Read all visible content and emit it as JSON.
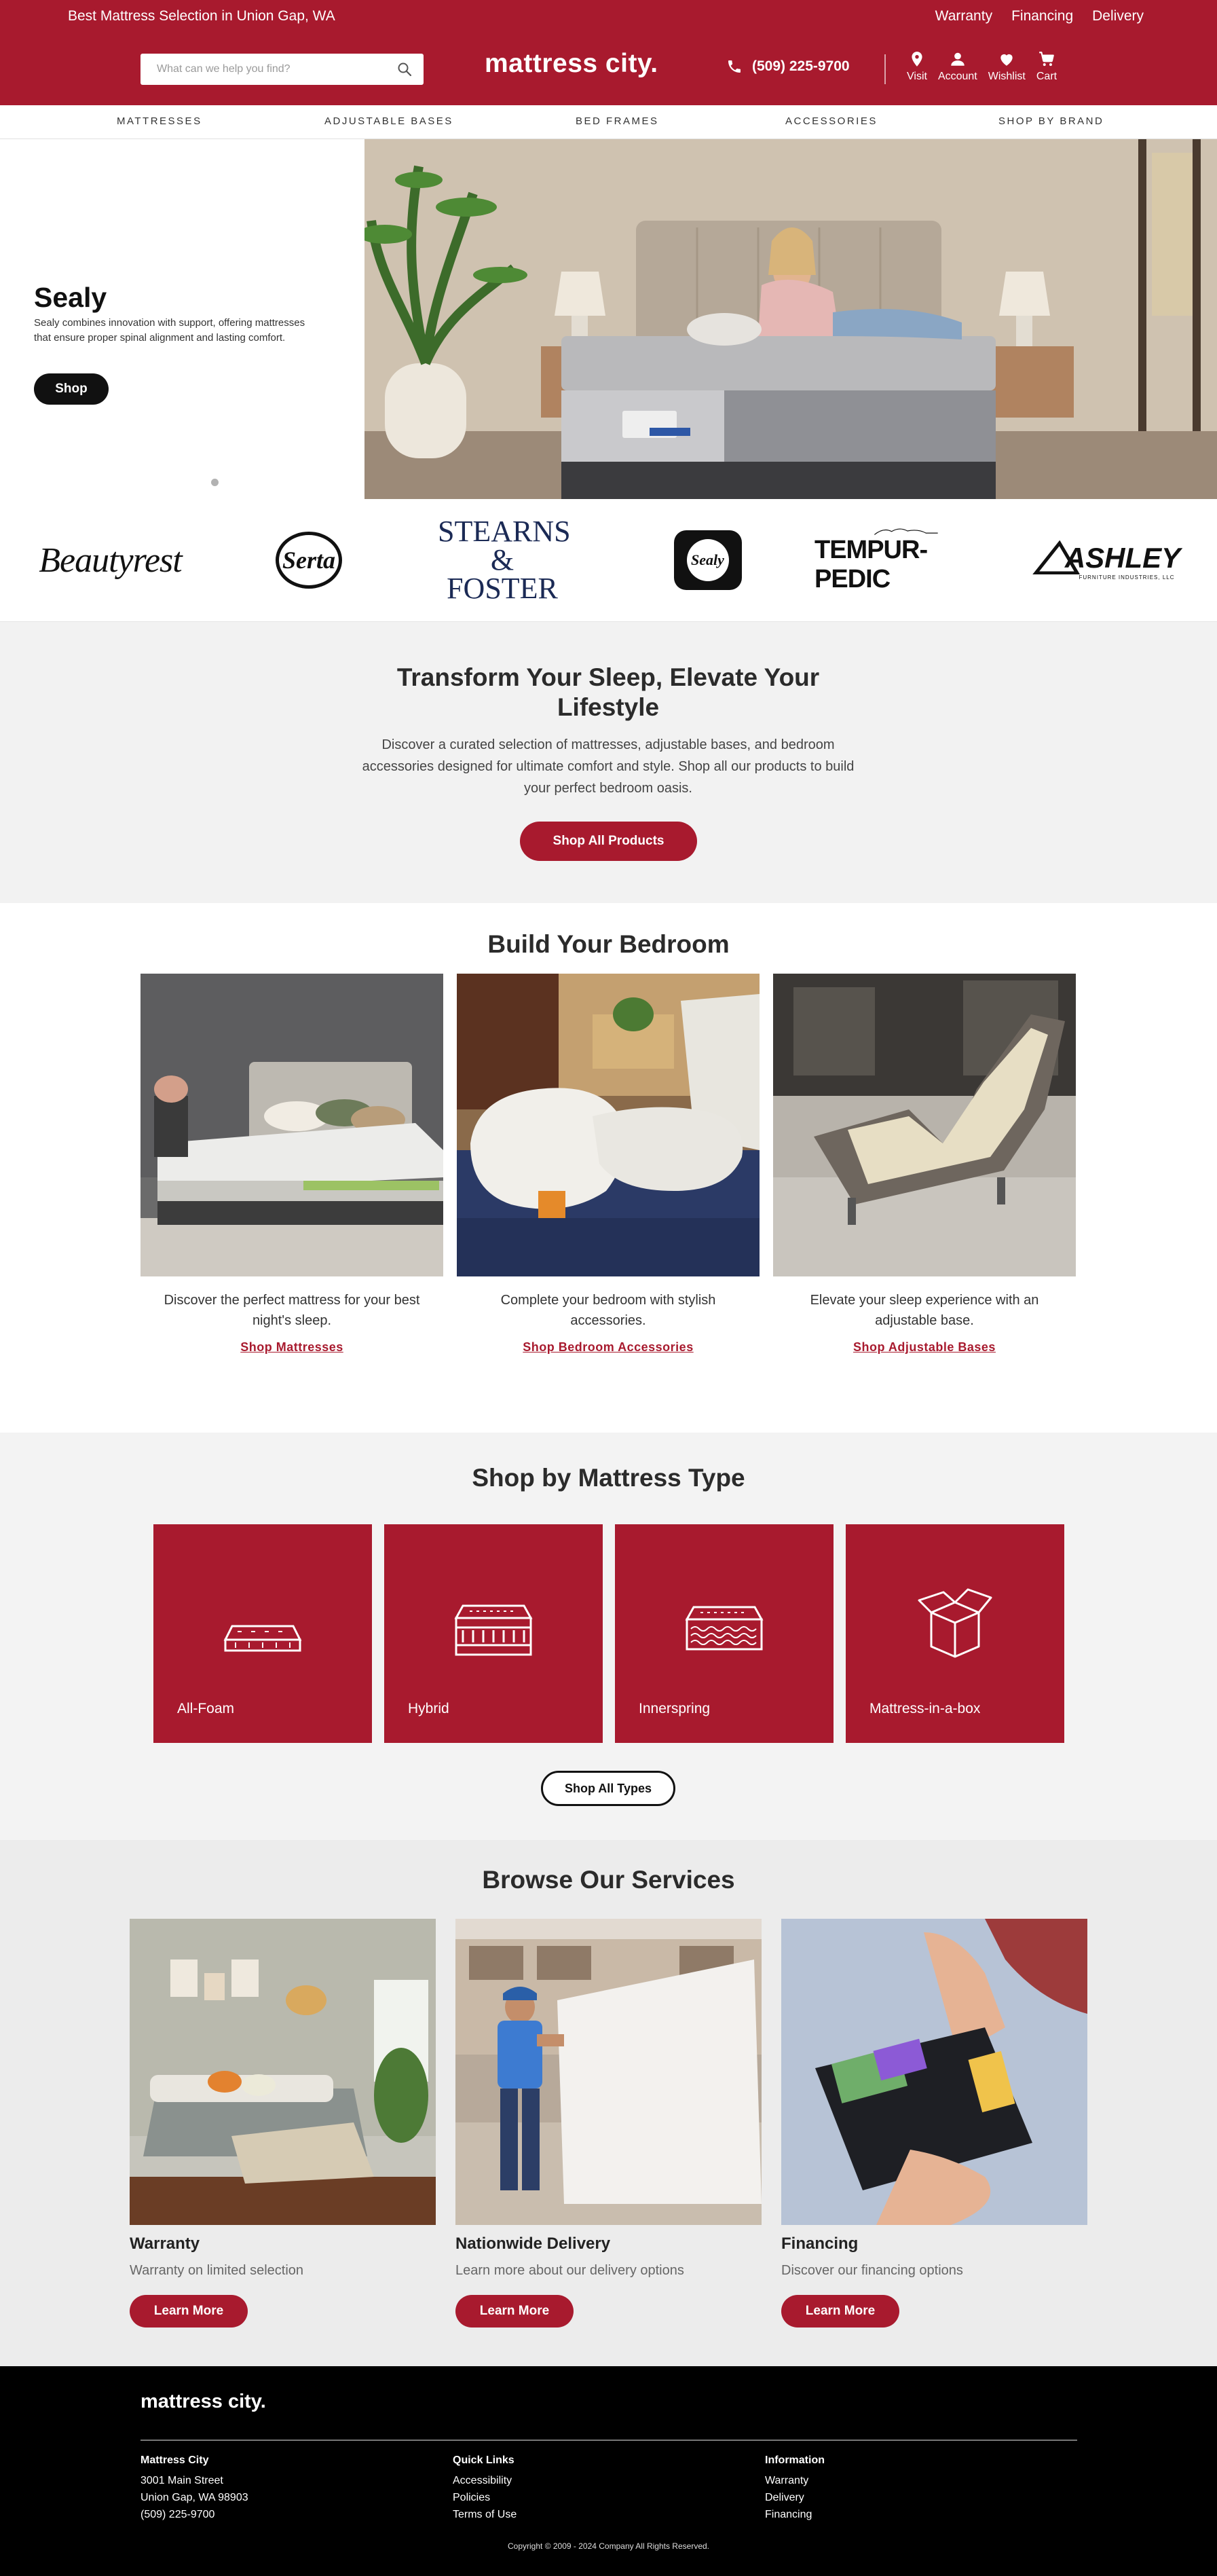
{
  "header": {
    "promo": "Best Mattress Selection in Union Gap, WA",
    "top_links": [
      "Warranty",
      "Financing",
      "Delivery"
    ],
    "search_placeholder": "What can we help you find?",
    "brand": "mattress city.",
    "phone": "(509) 225-9700",
    "icons": [
      {
        "label": "Visit",
        "icon": "location-pin-icon"
      },
      {
        "label": "Account",
        "icon": "user-icon"
      },
      {
        "label": "Wishlist",
        "icon": "heart-icon"
      },
      {
        "label": "Cart",
        "icon": "cart-icon"
      }
    ]
  },
  "nav": [
    "MATTRESSES",
    "ADJUSTABLE BASES",
    "BED FRAMES",
    "ACCESSORIES",
    "SHOP BY BRAND"
  ],
  "hero": {
    "title": "Sealy",
    "description": "Sealy combines innovation with support, offering mattresses that ensure proper spinal alignment and lasting comfort.",
    "button": "Shop",
    "slide_count": 5,
    "active_slide": 1
  },
  "brands": [
    "Beautyrest",
    "Serta",
    "STEARNS & FOSTER",
    "Sealy",
    "TEMPUR-PEDIC",
    "ASHLEY"
  ],
  "brand_sub": {
    "ashley": "FURNITURE INDUSTRIES, LLC"
  },
  "transform": {
    "title": "Transform Your Sleep, Elevate Your Lifestyle",
    "text": "Discover a curated selection of mattresses, adjustable bases, and bedroom accessories designed for ultimate comfort and style. Shop all our products to build your perfect bedroom oasis.",
    "button": "Shop All Products"
  },
  "build": {
    "title": "Build Your Bedroom",
    "cards": [
      {
        "text": "Discover the perfect mattress for your best night's sleep.",
        "link": "Shop Mattresses"
      },
      {
        "text": "Complete your bedroom with stylish accessories.",
        "link": "Shop Bedroom Accessories"
      },
      {
        "text": "Elevate your sleep experience with an adjustable base.",
        "link": "Shop Adjustable Bases"
      }
    ]
  },
  "mattress_types": {
    "title": "Shop by Mattress Type",
    "types": [
      {
        "label": "All-Foam",
        "icon": "foam-mattress-icon"
      },
      {
        "label": "Hybrid",
        "icon": "hybrid-mattress-icon"
      },
      {
        "label": "Innerspring",
        "icon": "innerspring-mattress-icon"
      },
      {
        "label": "Mattress-in-a-box",
        "icon": "box-icon"
      }
    ],
    "button": "Shop All Types"
  },
  "services": {
    "title": "Browse Our Services",
    "cards": [
      {
        "title": "Warranty",
        "text": "Warranty on limited selection",
        "button": "Learn More"
      },
      {
        "title": "Nationwide Delivery",
        "text": "Learn more about our delivery options",
        "button": "Learn More"
      },
      {
        "title": "Financing",
        "text": "Discover our financing options",
        "button": "Learn More"
      }
    ]
  },
  "footer": {
    "brand": "mattress city.",
    "city": {
      "title": "Mattress City",
      "lines": [
        "3001 Main Street",
        "Union Gap, WA 98903",
        "(509) 225-9700"
      ]
    },
    "quick": {
      "title": "Quick Links",
      "lines": [
        "Accessibility",
        "Policies",
        "Terms of Use"
      ]
    },
    "info": {
      "title": "Information",
      "lines": [
        "Warranty",
        "Delivery",
        "Financing"
      ]
    },
    "copyright": "Copyright © 2009 - 2024 Company All Rights Reserved."
  },
  "colors": {
    "brand_red": "#a81a2e",
    "black": "#000000",
    "light_gray": "#f2f2f2"
  }
}
